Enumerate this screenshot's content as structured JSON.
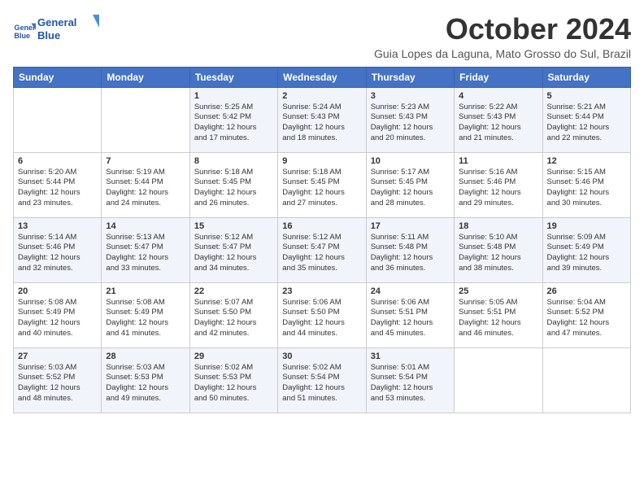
{
  "logo": {
    "line1": "General",
    "line2": "Blue"
  },
  "title": "October 2024",
  "subtitle": "Guia Lopes da Laguna, Mato Grosso do Sul, Brazil",
  "days_header": [
    "Sunday",
    "Monday",
    "Tuesday",
    "Wednesday",
    "Thursday",
    "Friday",
    "Saturday"
  ],
  "weeks": [
    [
      {
        "day": "",
        "text": ""
      },
      {
        "day": "",
        "text": ""
      },
      {
        "day": "1",
        "text": "Sunrise: 5:25 AM\nSunset: 5:42 PM\nDaylight: 12 hours\nand 17 minutes."
      },
      {
        "day": "2",
        "text": "Sunrise: 5:24 AM\nSunset: 5:43 PM\nDaylight: 12 hours\nand 18 minutes."
      },
      {
        "day": "3",
        "text": "Sunrise: 5:23 AM\nSunset: 5:43 PM\nDaylight: 12 hours\nand 20 minutes."
      },
      {
        "day": "4",
        "text": "Sunrise: 5:22 AM\nSunset: 5:43 PM\nDaylight: 12 hours\nand 21 minutes."
      },
      {
        "day": "5",
        "text": "Sunrise: 5:21 AM\nSunset: 5:44 PM\nDaylight: 12 hours\nand 22 minutes."
      }
    ],
    [
      {
        "day": "6",
        "text": "Sunrise: 5:20 AM\nSunset: 5:44 PM\nDaylight: 12 hours\nand 23 minutes."
      },
      {
        "day": "7",
        "text": "Sunrise: 5:19 AM\nSunset: 5:44 PM\nDaylight: 12 hours\nand 24 minutes."
      },
      {
        "day": "8",
        "text": "Sunrise: 5:18 AM\nSunset: 5:45 PM\nDaylight: 12 hours\nand 26 minutes."
      },
      {
        "day": "9",
        "text": "Sunrise: 5:18 AM\nSunset: 5:45 PM\nDaylight: 12 hours\nand 27 minutes."
      },
      {
        "day": "10",
        "text": "Sunrise: 5:17 AM\nSunset: 5:45 PM\nDaylight: 12 hours\nand 28 minutes."
      },
      {
        "day": "11",
        "text": "Sunrise: 5:16 AM\nSunset: 5:46 PM\nDaylight: 12 hours\nand 29 minutes."
      },
      {
        "day": "12",
        "text": "Sunrise: 5:15 AM\nSunset: 5:46 PM\nDaylight: 12 hours\nand 30 minutes."
      }
    ],
    [
      {
        "day": "13",
        "text": "Sunrise: 5:14 AM\nSunset: 5:46 PM\nDaylight: 12 hours\nand 32 minutes."
      },
      {
        "day": "14",
        "text": "Sunrise: 5:13 AM\nSunset: 5:47 PM\nDaylight: 12 hours\nand 33 minutes."
      },
      {
        "day": "15",
        "text": "Sunrise: 5:12 AM\nSunset: 5:47 PM\nDaylight: 12 hours\nand 34 minutes."
      },
      {
        "day": "16",
        "text": "Sunrise: 5:12 AM\nSunset: 5:47 PM\nDaylight: 12 hours\nand 35 minutes."
      },
      {
        "day": "17",
        "text": "Sunrise: 5:11 AM\nSunset: 5:48 PM\nDaylight: 12 hours\nand 36 minutes."
      },
      {
        "day": "18",
        "text": "Sunrise: 5:10 AM\nSunset: 5:48 PM\nDaylight: 12 hours\nand 38 minutes."
      },
      {
        "day": "19",
        "text": "Sunrise: 5:09 AM\nSunset: 5:49 PM\nDaylight: 12 hours\nand 39 minutes."
      }
    ],
    [
      {
        "day": "20",
        "text": "Sunrise: 5:08 AM\nSunset: 5:49 PM\nDaylight: 12 hours\nand 40 minutes."
      },
      {
        "day": "21",
        "text": "Sunrise: 5:08 AM\nSunset: 5:49 PM\nDaylight: 12 hours\nand 41 minutes."
      },
      {
        "day": "22",
        "text": "Sunrise: 5:07 AM\nSunset: 5:50 PM\nDaylight: 12 hours\nand 42 minutes."
      },
      {
        "day": "23",
        "text": "Sunrise: 5:06 AM\nSunset: 5:50 PM\nDaylight: 12 hours\nand 44 minutes."
      },
      {
        "day": "24",
        "text": "Sunrise: 5:06 AM\nSunset: 5:51 PM\nDaylight: 12 hours\nand 45 minutes."
      },
      {
        "day": "25",
        "text": "Sunrise: 5:05 AM\nSunset: 5:51 PM\nDaylight: 12 hours\nand 46 minutes."
      },
      {
        "day": "26",
        "text": "Sunrise: 5:04 AM\nSunset: 5:52 PM\nDaylight: 12 hours\nand 47 minutes."
      }
    ],
    [
      {
        "day": "27",
        "text": "Sunrise: 5:03 AM\nSunset: 5:52 PM\nDaylight: 12 hours\nand 48 minutes."
      },
      {
        "day": "28",
        "text": "Sunrise: 5:03 AM\nSunset: 5:53 PM\nDaylight: 12 hours\nand 49 minutes."
      },
      {
        "day": "29",
        "text": "Sunrise: 5:02 AM\nSunset: 5:53 PM\nDaylight: 12 hours\nand 50 minutes."
      },
      {
        "day": "30",
        "text": "Sunrise: 5:02 AM\nSunset: 5:54 PM\nDaylight: 12 hours\nand 51 minutes."
      },
      {
        "day": "31",
        "text": "Sunrise: 5:01 AM\nSunset: 5:54 PM\nDaylight: 12 hours\nand 53 minutes."
      },
      {
        "day": "",
        "text": ""
      },
      {
        "day": "",
        "text": ""
      }
    ]
  ]
}
